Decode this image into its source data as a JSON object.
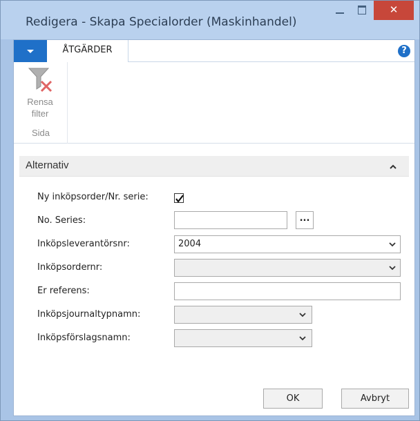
{
  "window": {
    "title": "Redigera - Skapa Specialorder (Maskinhandel)",
    "close_glyph": "✕"
  },
  "ribbon": {
    "tab_label": "ÅTGÄRDER",
    "help_glyph": "?",
    "clear_filter_label_line1": "Rensa",
    "clear_filter_label_line2": "filter",
    "group_label": "Sida"
  },
  "section": {
    "title": "Alternativ"
  },
  "fields": {
    "new_order_label": "Ny inköpsorder/Nr. serie:",
    "new_order_checked": true,
    "no_series_label": "No. Series:",
    "no_series_value": "",
    "lookup_label": "...",
    "vendor_no_label": "Inköpsleverantörsnr:",
    "vendor_no_value": "2004",
    "order_no_label": "Inköpsordernr:",
    "order_no_value": "",
    "your_reference_label": "Er referens:",
    "your_reference_value": "",
    "journal_template_label": "Inköpsjournaltypnamn:",
    "journal_template_value": "",
    "worksheet_label": "Inköpsförslagsnamn:",
    "worksheet_value": ""
  },
  "buttons": {
    "ok_label": "OK",
    "cancel_label": "Avbryt"
  },
  "colors": {
    "accent": "#1f70c8",
    "close_red": "#c7473a",
    "titlebar": "#b9d1ee"
  }
}
